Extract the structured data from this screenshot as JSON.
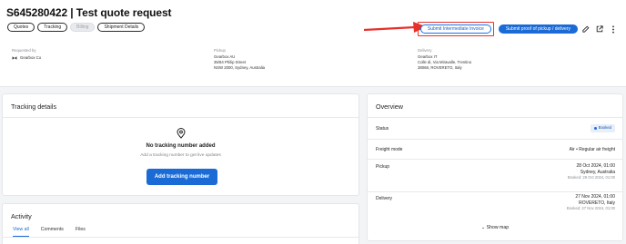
{
  "header": {
    "title": "S645280422 | Test quote request",
    "tabs": [
      {
        "label": "Quotes",
        "disabled": false
      },
      {
        "label": "Tracking",
        "disabled": false
      },
      {
        "label": "Billing",
        "disabled": true
      },
      {
        "label": "Shipment Details",
        "disabled": false
      }
    ],
    "actions": {
      "intermediate_invoice": "Submit Intermediate Invoice",
      "proof_of_pickup": "Submit proof of pickup / delivery"
    }
  },
  "meta": {
    "requested_by": {
      "label": "Requested by",
      "company": "Gearbox Co"
    },
    "pickup": {
      "label": "Pickup",
      "line1": "Gearbox AU",
      "line2": "35/84 Philip Street",
      "line3": "NSW 2000, Sydney, Australia"
    },
    "delivery": {
      "label": "Delivery",
      "line1": "Gearbox IT",
      "line2": "Colle di, Via Miravalle, Trentino",
      "line3": "38068, ROVERETO, Italy"
    }
  },
  "tracking": {
    "title": "Tracking details",
    "empty_title": "No tracking number added",
    "empty_subtitle": "Add a tracking number to get live updates",
    "add_button": "Add tracking number"
  },
  "activity": {
    "title": "Activity",
    "tabs": [
      "View all",
      "Comments",
      "Files"
    ]
  },
  "overview": {
    "title": "Overview",
    "status_label": "Status",
    "status_value": "Booked",
    "freight_label": "Freight mode",
    "freight_value": "Air • Regular air freight",
    "pickup_label": "Pickup",
    "pickup_date": "28 Oct 2024, 01:00",
    "pickup_place": "Sydney, Australia",
    "pickup_booked": "Booked: 28 Oct 2024, 01:00",
    "delivery_label": "Delivery",
    "delivery_date": "27 Nov 2024, 01:00",
    "delivery_place": "ROVERETO, Italy",
    "delivery_booked": "Booked: 27 Nov 2024, 01:00",
    "show_map": "Show map"
  },
  "colors": {
    "accent": "#1a6bd6",
    "highlight": "#e8302a",
    "badge_bg": "#e6effb"
  }
}
